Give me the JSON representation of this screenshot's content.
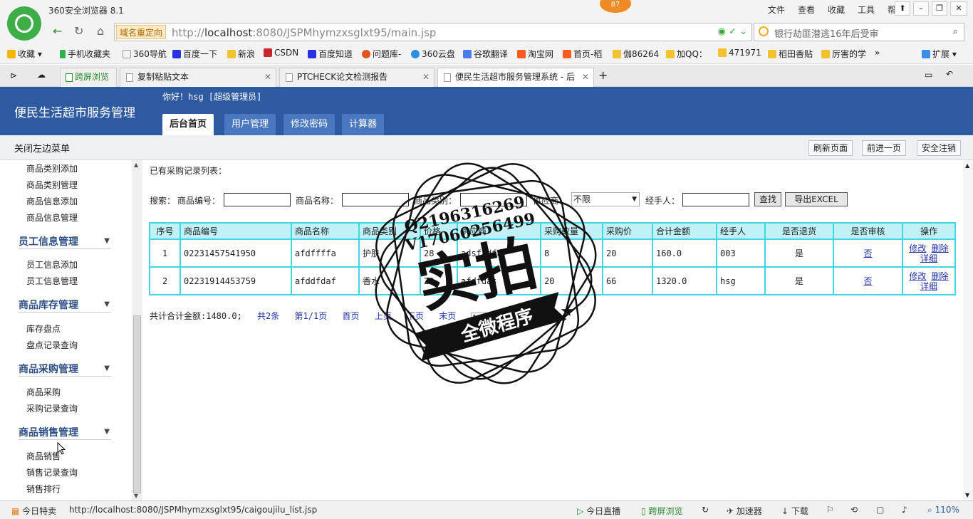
{
  "browser": {
    "app_title": "360安全浏览器 8.1",
    "badge": "87",
    "menu": [
      "文件",
      "查看",
      "收藏",
      "工具",
      "帮助"
    ],
    "domain_tag": "域名重定向",
    "url_prefix": "http://",
    "url_host": "localhost",
    "url_rest": ":8080/JSPMhymzxsglxt95/main.jsp",
    "search_placeholder": "银行劫匪潜逃16年后受审",
    "bookmarks": [
      "收藏",
      "手机收藏夹",
      "360导航",
      "百度一下",
      "新浪",
      "CSDN",
      "百度知道",
      "问题库-",
      "360云盘",
      "谷歌翻译",
      "淘宝网",
      "首页-稻",
      "伽86264",
      "加QQ：",
      "471971",
      "稻田香贴",
      "厉害的学",
      "扩展"
    ],
    "tabs": [
      "跨屏浏览",
      "复制粘贴文本",
      "PTCHECK论文检测报告",
      "便民生活超市服务管理系统 - 后"
    ],
    "status_url": "http://localhost:8080/JSPMhymzxsglxt95/caigoujilu_list.jsp",
    "status_left": "今日特卖",
    "status_items": [
      "今日直播",
      "跨屏浏览",
      "加速器",
      "下载"
    ],
    "zoom": "110%"
  },
  "header": {
    "brand": "便民生活超市服务管理",
    "greeting": "你好！hsg [超级管理员]",
    "nav": [
      "后台首页",
      "用户管理",
      "修改密码",
      "计算器"
    ]
  },
  "subbar": {
    "close_menu": "关闭左边菜单",
    "buttons": [
      "刷新页面",
      "前进一页",
      "安全注销"
    ]
  },
  "sidebar": {
    "groups": [
      {
        "items": [
          "商品类别添加",
          "商品类别管理",
          "商品信息添加",
          "商品信息管理"
        ]
      },
      {
        "title": "员工信息管理",
        "items": [
          "员工信息添加",
          "员工信息管理"
        ]
      },
      {
        "title": "商品库存管理",
        "items": [
          "库存盘点",
          "盘点记录查询"
        ]
      },
      {
        "title": "商品采购管理",
        "items": [
          "商品采购",
          "采购记录查询"
        ]
      },
      {
        "title": "商品销售管理",
        "items": [
          "商品销售",
          "销售记录查询",
          "销售排行"
        ]
      }
    ]
  },
  "main": {
    "list_title": "已有采购记录列表：",
    "search": {
      "label": "搜索：",
      "code_label": "商品编号：",
      "name_label": "商品名称：",
      "category_label": "商品类别：",
      "supplier_label": "供应商：",
      "supplier_value": "不限",
      "handler_label": "经手人：",
      "find_button": "查找",
      "export_button": "导出EXCEL"
    },
    "columns": [
      "序号",
      "商品编号",
      "商品名称",
      "商品类别",
      "价格",
      "供应商",
      "采购数量",
      "采购价",
      "合计金额",
      "经手人",
      "是否退货",
      "是否审核",
      "操作"
    ],
    "rows": [
      {
        "no": "1",
        "code": "02231457541950",
        "name": "afdffffa",
        "category": "护肤",
        "price": "28",
        "supplier": "adsfadfa",
        "qty": "8",
        "cost": "20",
        "total": "160.0",
        "handler": "003",
        "returned": "是",
        "audited": "否"
      },
      {
        "no": "2",
        "code": "02231914453759",
        "name": "afddfdaf",
        "category": "香水",
        "price": "22",
        "supplier": "afdfdas",
        "qty": "20",
        "cost": "66",
        "total": "1320.0",
        "handler": "hsg",
        "returned": "是",
        "audited": "否"
      }
    ],
    "ops": {
      "edit": "修改",
      "delete": "删除",
      "detail": "详细"
    },
    "pager": {
      "total": "共计合计金额:1480.0;",
      "count": "共2条",
      "page": "第1/1页",
      "first": "首页",
      "prev": "上页",
      "next": "下页",
      "last": "末页",
      "current": "1"
    }
  },
  "watermark": {
    "line1": "Q2196316269",
    "line2": "V17060256499",
    "big": "实拍",
    "banner": "全微程序"
  }
}
